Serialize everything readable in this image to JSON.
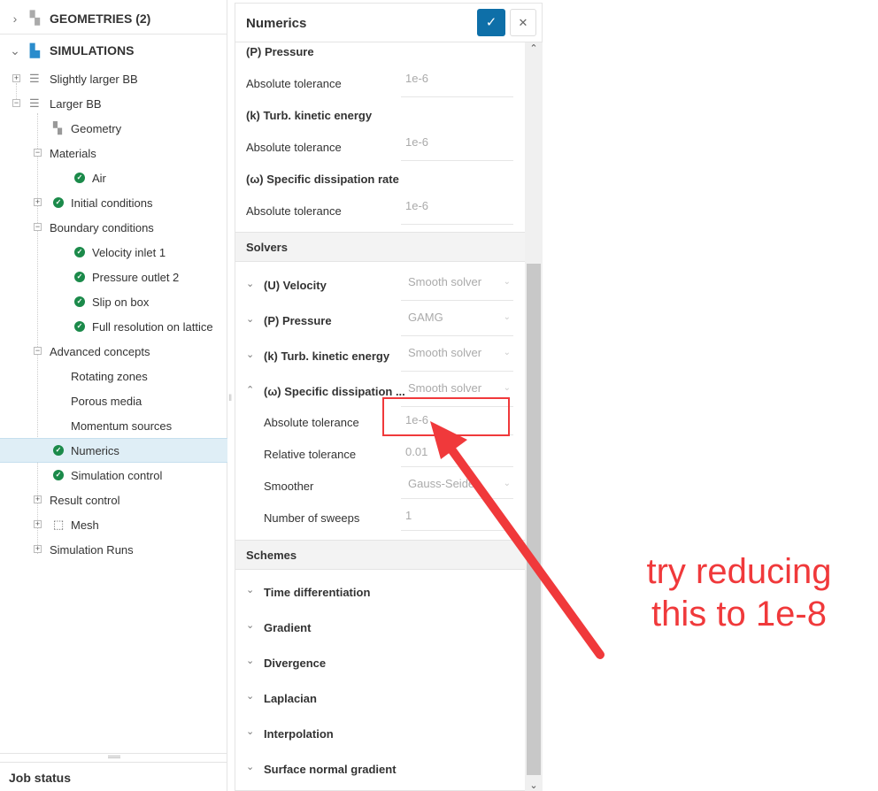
{
  "tree": {
    "geometries": "GEOMETRIES (2)",
    "simulations": "SIMULATIONS",
    "items": [
      "Slightly larger BB",
      "Larger BB",
      "Geometry",
      "Materials",
      "Air",
      "Initial conditions",
      "Boundary conditions",
      "Velocity inlet 1",
      "Pressure outlet 2",
      "Slip on box",
      "Full resolution on lattice",
      "Advanced concepts",
      "Rotating zones",
      "Porous media",
      "Momentum sources",
      "Numerics",
      "Simulation control",
      "Result control",
      "Mesh",
      "Simulation Runs"
    ],
    "job_status": "Job status"
  },
  "panel": {
    "title": "Numerics",
    "tolerances": [
      {
        "heading": "(P) Pressure",
        "label": "Absolute tolerance",
        "value": "1e-6"
      },
      {
        "heading": "(k) Turb. kinetic energy",
        "label": "Absolute tolerance",
        "value": "1e-6"
      },
      {
        "heading": "(ω) Specific dissipation rate",
        "label": "Absolute tolerance",
        "value": "1e-6"
      }
    ],
    "solvers_title": "Solvers",
    "solvers": [
      {
        "name": "(U) Velocity",
        "value": "Smooth solver"
      },
      {
        "name": "(P) Pressure",
        "value": "GAMG"
      },
      {
        "name": "(k) Turb. kinetic energy",
        "value": "Smooth solver"
      },
      {
        "name": "(ω) Specific dissipation ...",
        "value": "Smooth solver"
      }
    ],
    "solver_fields": [
      {
        "label": "Absolute tolerance",
        "value": "1e-6"
      },
      {
        "label": "Relative tolerance",
        "value": "0.01"
      },
      {
        "label": "Smoother",
        "value": "Gauss-Seidel"
      },
      {
        "label": "Number of sweeps",
        "value": "1"
      }
    ],
    "schemes_title": "Schemes",
    "schemes": [
      "Time differentiation",
      "Gradient",
      "Divergence",
      "Laplacian",
      "Interpolation",
      "Surface normal gradient"
    ]
  },
  "annotation": {
    "line1": "try reducing",
    "line2": "this to 1e-8",
    "color": "#f0393b"
  }
}
